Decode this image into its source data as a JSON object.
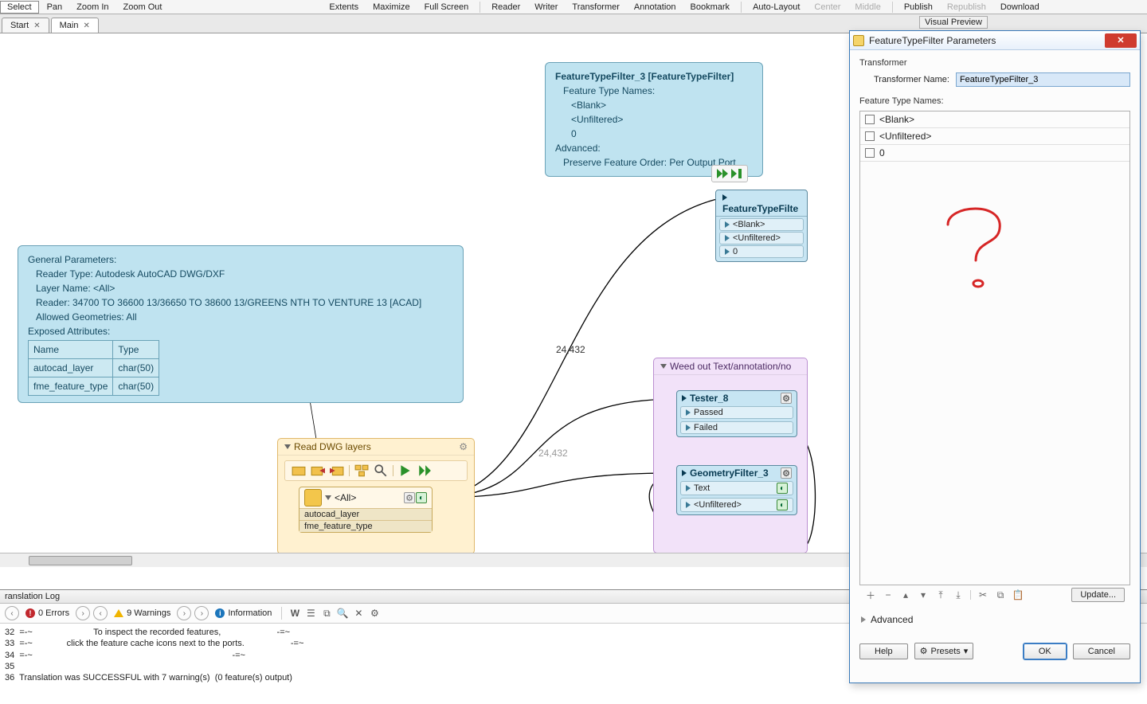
{
  "toolbar": {
    "select": "Select",
    "pan": "Pan",
    "zoom_in": "Zoom In",
    "zoom_out": "Zoom Out",
    "extents": "Extents",
    "maximize": "Maximize",
    "full_screen": "Full Screen",
    "reader": "Reader",
    "writer": "Writer",
    "transformer": "Transformer",
    "annotation": "Annotation",
    "bookmark": "Bookmark",
    "auto_layout": "Auto-Layout",
    "center": "Center",
    "middle": "Middle",
    "publish": "Publish",
    "republish": "Republish",
    "download": "Download"
  },
  "visual_preview": "Visual Preview",
  "tabs": {
    "start": "Start",
    "main": "Main"
  },
  "tooltip_ftf": {
    "title": "FeatureTypeFilter_3 [FeatureTypeFilter]",
    "l1": "Feature Type Names:",
    "v1": "<Blank>",
    "v2": "<Unfiltered>",
    "v3": "0",
    "l2": "Advanced:",
    "v4": "Preserve Feature Order: Per Output Port"
  },
  "tooltip_reader": {
    "h": "General Parameters:",
    "r1": "Reader Type: Autodesk AutoCAD DWG/DXF",
    "r2": "Layer Name: <All>",
    "r3": "Reader: 34700 TO 36600 13/36650 TO 38600 13/GREENS NTH TO VENTURE 13 [ACAD]",
    "r4": "Allowed Geometries: All",
    "h2": "Exposed Attributes:",
    "th_name": "Name",
    "th_type": "Type",
    "a1n": "autocad_layer",
    "a1t": "char(50)",
    "a2n": "fme_feature_type",
    "a2t": "char(50)"
  },
  "ftf_node": {
    "title": "FeatureTypeFilte",
    "p1": "<Blank>",
    "p2": "<Unfiltered>",
    "p3": "0"
  },
  "bk_orange": {
    "title": "Read DWG layers",
    "all": "<All>",
    "attr1": "autocad_layer",
    "attr2": "fme_feature_type"
  },
  "bk_purple": {
    "title": "Weed out Text/annotation/no",
    "tester_title": "Tester_8",
    "tester_p1": "Passed",
    "tester_p2": "Failed",
    "gf_title": "GeometryFilter_3",
    "gf_p1": "Text",
    "gf_p2": "<Unfiltered>"
  },
  "flow": {
    "count1": "24,432",
    "count2": "24,432"
  },
  "log": {
    "title": "ranslation Log",
    "errors": "0 Errors",
    "warnings": "9 Warnings",
    "info": "Information",
    "l1": "32  =-~                         To inspect the recorded features,                       -=~",
    "l2": "33  =-~              click the feature cache icons next to the ports.                   -=~",
    "l3": "34  =-~                                                                                  -=~",
    "l4": "35",
    "l5": "36  Translation was SUCCESSFUL with 7 warning(s)  (0 feature(s) output)"
  },
  "dialog": {
    "title": "FeatureTypeFilter Parameters",
    "section1": "Transformer",
    "name_label": "Transformer Name:",
    "name_value": "FeatureTypeFilter_3",
    "section2": "Feature Type Names:",
    "row1": "<Blank>",
    "row2": "<Unfiltered>",
    "row3": "0",
    "update": "Update...",
    "advanced": "Advanced",
    "help": "Help",
    "presets": "Presets",
    "ok": "OK",
    "cancel": "Cancel"
  }
}
